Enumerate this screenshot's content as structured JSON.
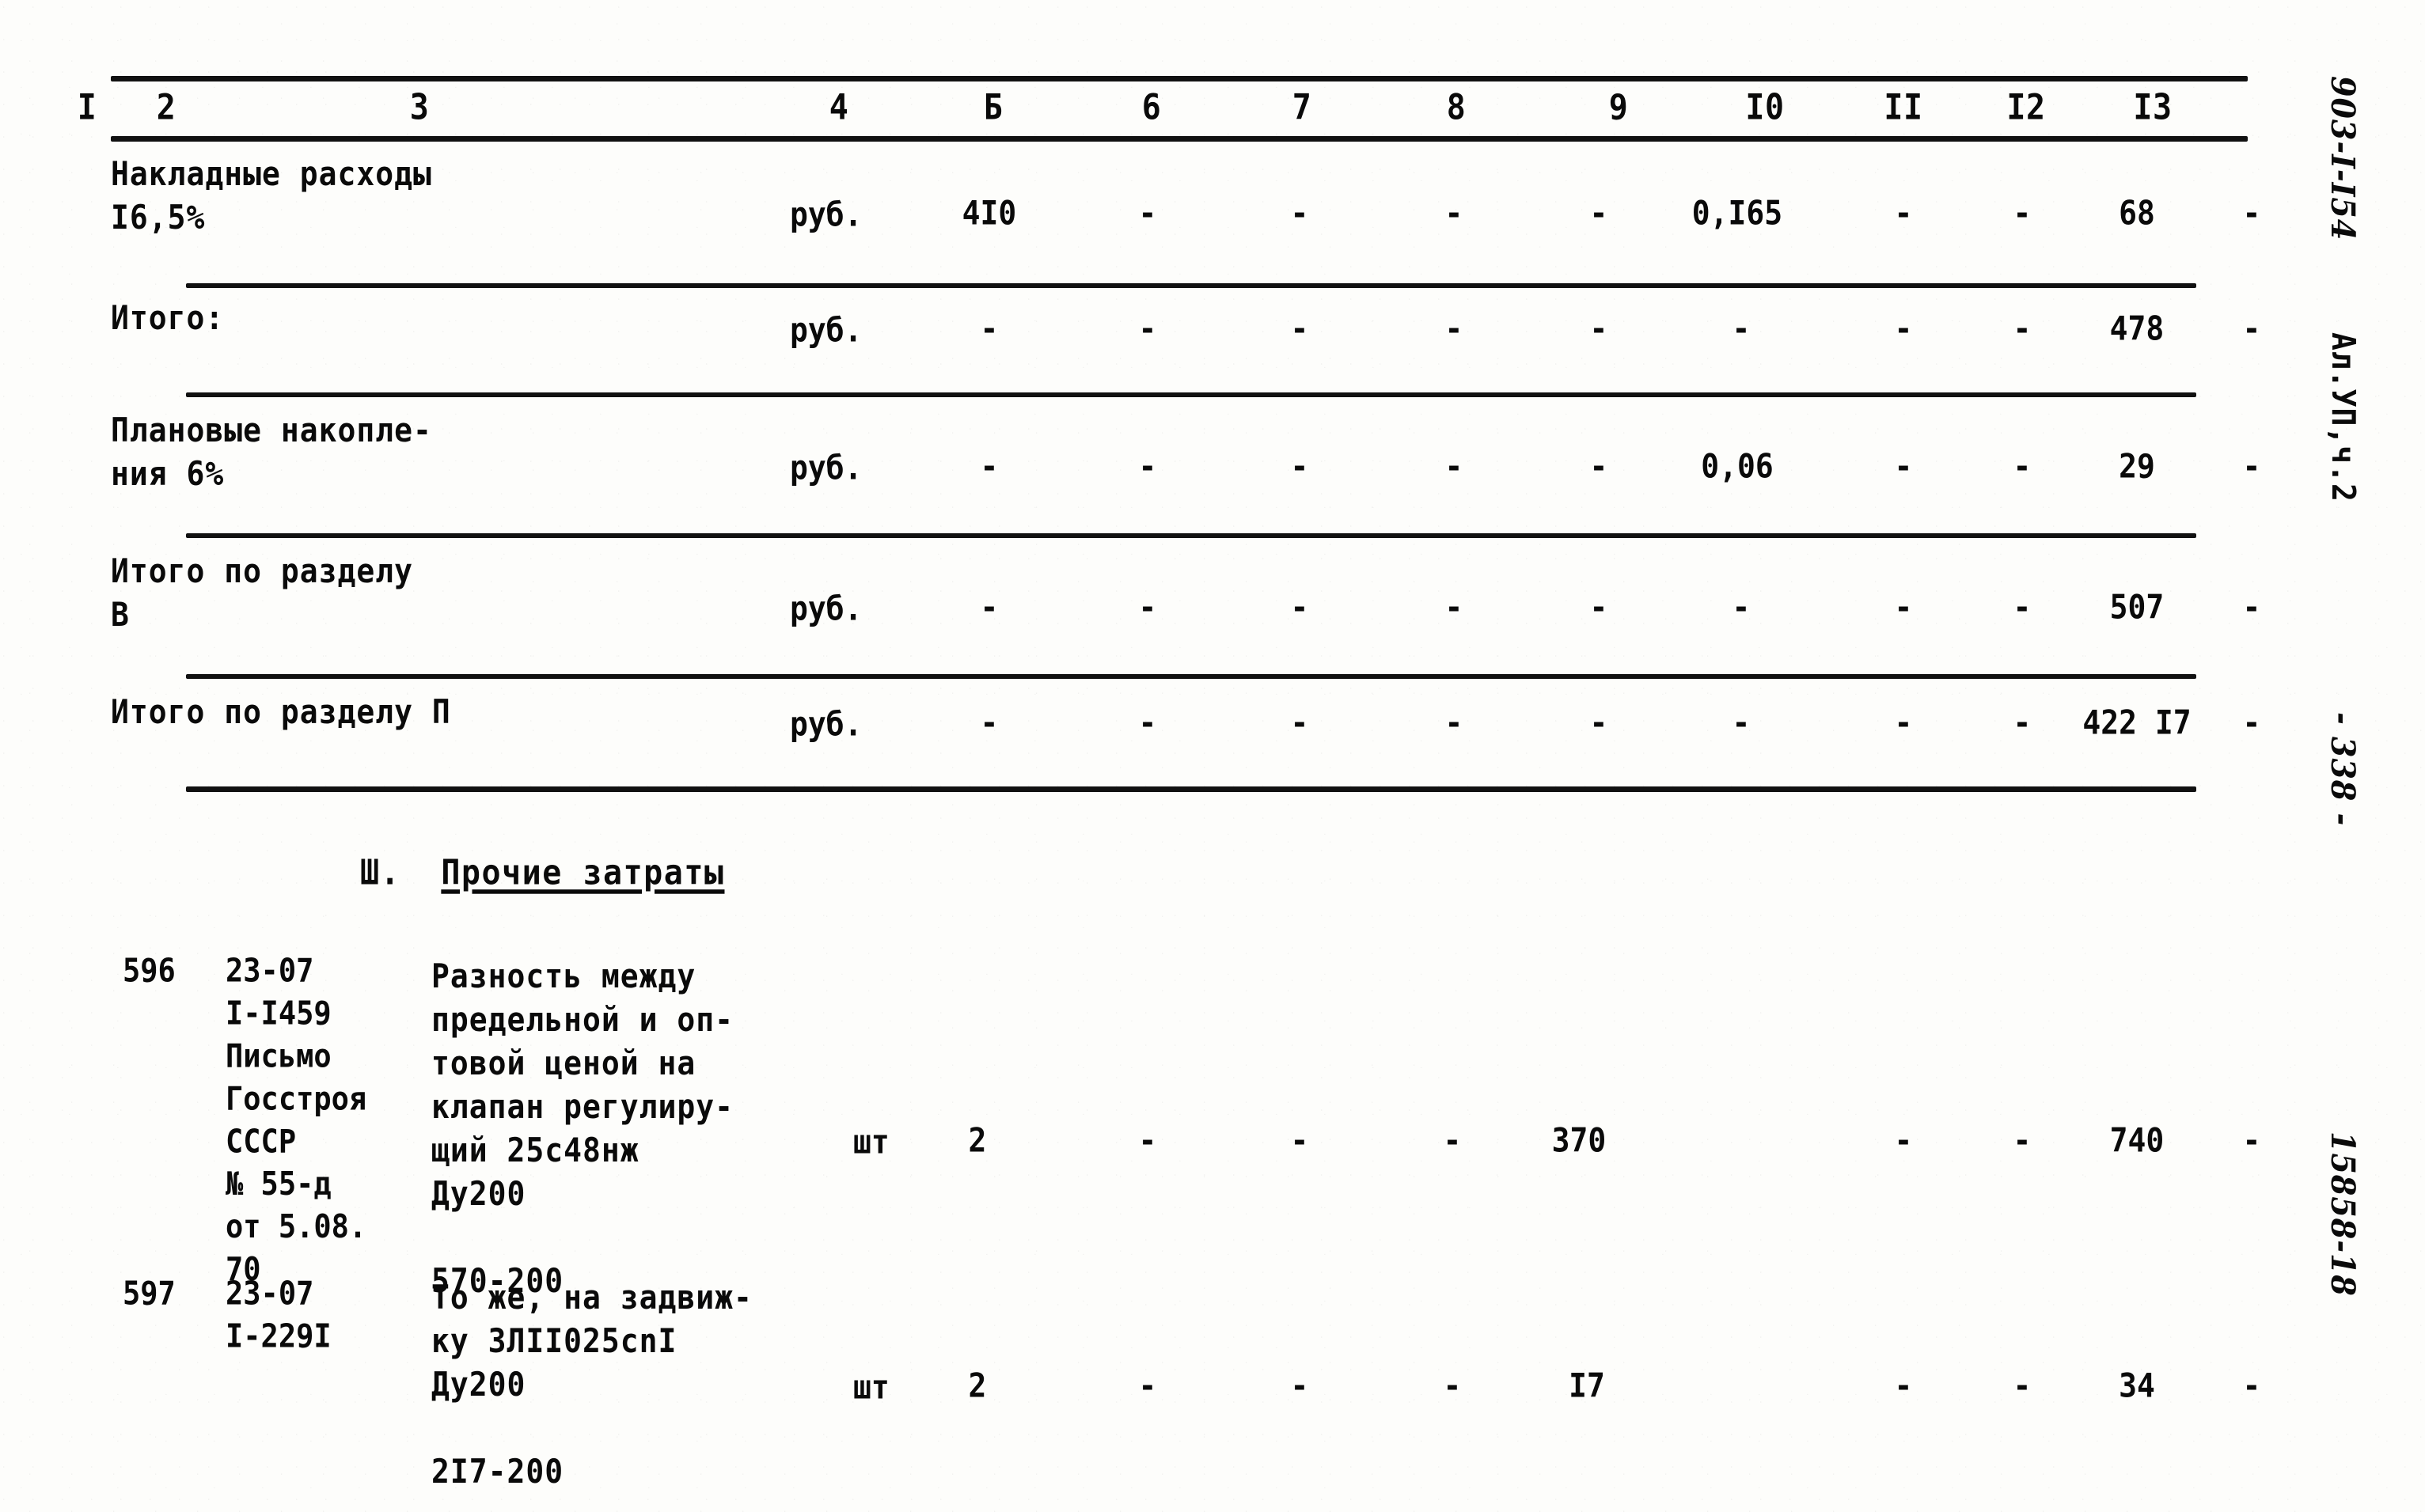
{
  "document": {
    "margin_right": {
      "doc_code": "903-I-I54",
      "album": "Ал.УП,ч.2",
      "page_number": "- 338 -",
      "archive_code": "15858-18"
    }
  },
  "table": {
    "column_headers": [
      "I",
      "2",
      "3",
      "4",
      "Б",
      "6",
      "7",
      "8",
      "9",
      "I0",
      "II",
      "I2",
      "I3"
    ],
    "rows": [
      {
        "code": "",
        "description": "Накладные расходы\nI6,5%",
        "unit": "руб.",
        "c5": "4I0",
        "c6": "-",
        "c7": "-",
        "c8": "-",
        "c9": "-",
        "c10": "0,I65",
        "c11": "-",
        "c12": "-",
        "c13": "68",
        "c14": "-"
      },
      {
        "code": "",
        "description": "Итого:",
        "unit": "руб.",
        "c5": "-",
        "c6": "-",
        "c7": "-",
        "c8": "-",
        "c9": "-",
        "c10": "-",
        "c11": "-",
        "c12": "-",
        "c13": "478",
        "c14": "-"
      },
      {
        "code": "",
        "description": "Плановые накопле-\nния 6%",
        "unit": "руб.",
        "c5": "-",
        "c6": "-",
        "c7": "-",
        "c8": "-",
        "c9": "-",
        "c10": "0,06",
        "c11": "-",
        "c12": "-",
        "c13": "29",
        "c14": "-"
      },
      {
        "code": "",
        "description": "Итого по разделу\n        В",
        "unit": "руб.",
        "c5": "-",
        "c6": "-",
        "c7": "-",
        "c8": "-",
        "c9": "-",
        "c10": "-",
        "c11": "-",
        "c12": "-",
        "c13": "507",
        "c14": "-"
      },
      {
        "code": "",
        "description": "Итого по разделу П",
        "unit": "руб.",
        "c5": "-",
        "c6": "-",
        "c7": "-",
        "c8": "-",
        "c9": "-",
        "c10": "-",
        "c11": "-",
        "c12": "-",
        "c13": "422 I7",
        "c14": "-"
      }
    ],
    "section": {
      "numeral": "Ш.",
      "title": "Прочие затраты"
    },
    "item_rows": [
      {
        "number": "596",
        "code": "23-07\nI-I459\nПисьмо\nГосстроя\nСССР\n№ 55-д\nот 5.08.\n    70",
        "description": "Разность между\n предельной и оп-\n товой ценой на\n клапан регулиру-\n щий 25с48нж\nДу200\n\n    570-200",
        "unit": "шт",
        "c5": "2",
        "c6": "-",
        "c7": "-",
        "c8": "-",
        "c9": "370",
        "c10": "",
        "c11": "-",
        "c12": "-",
        "c13": "740",
        "c14": "-"
      },
      {
        "number": "597",
        "code": "23-07\nI-229I",
        "description": "То же, на задвиж-\nку ЗЛII025сnI\nДу200\n\n   2I7-200",
        "unit": "шт",
        "c5": "2",
        "c6": "-",
        "c7": "-",
        "c8": "-",
        "c9": "I7",
        "c10": "",
        "c11": "-",
        "c12": "-",
        "c13": "34",
        "c14": "-"
      }
    ]
  }
}
